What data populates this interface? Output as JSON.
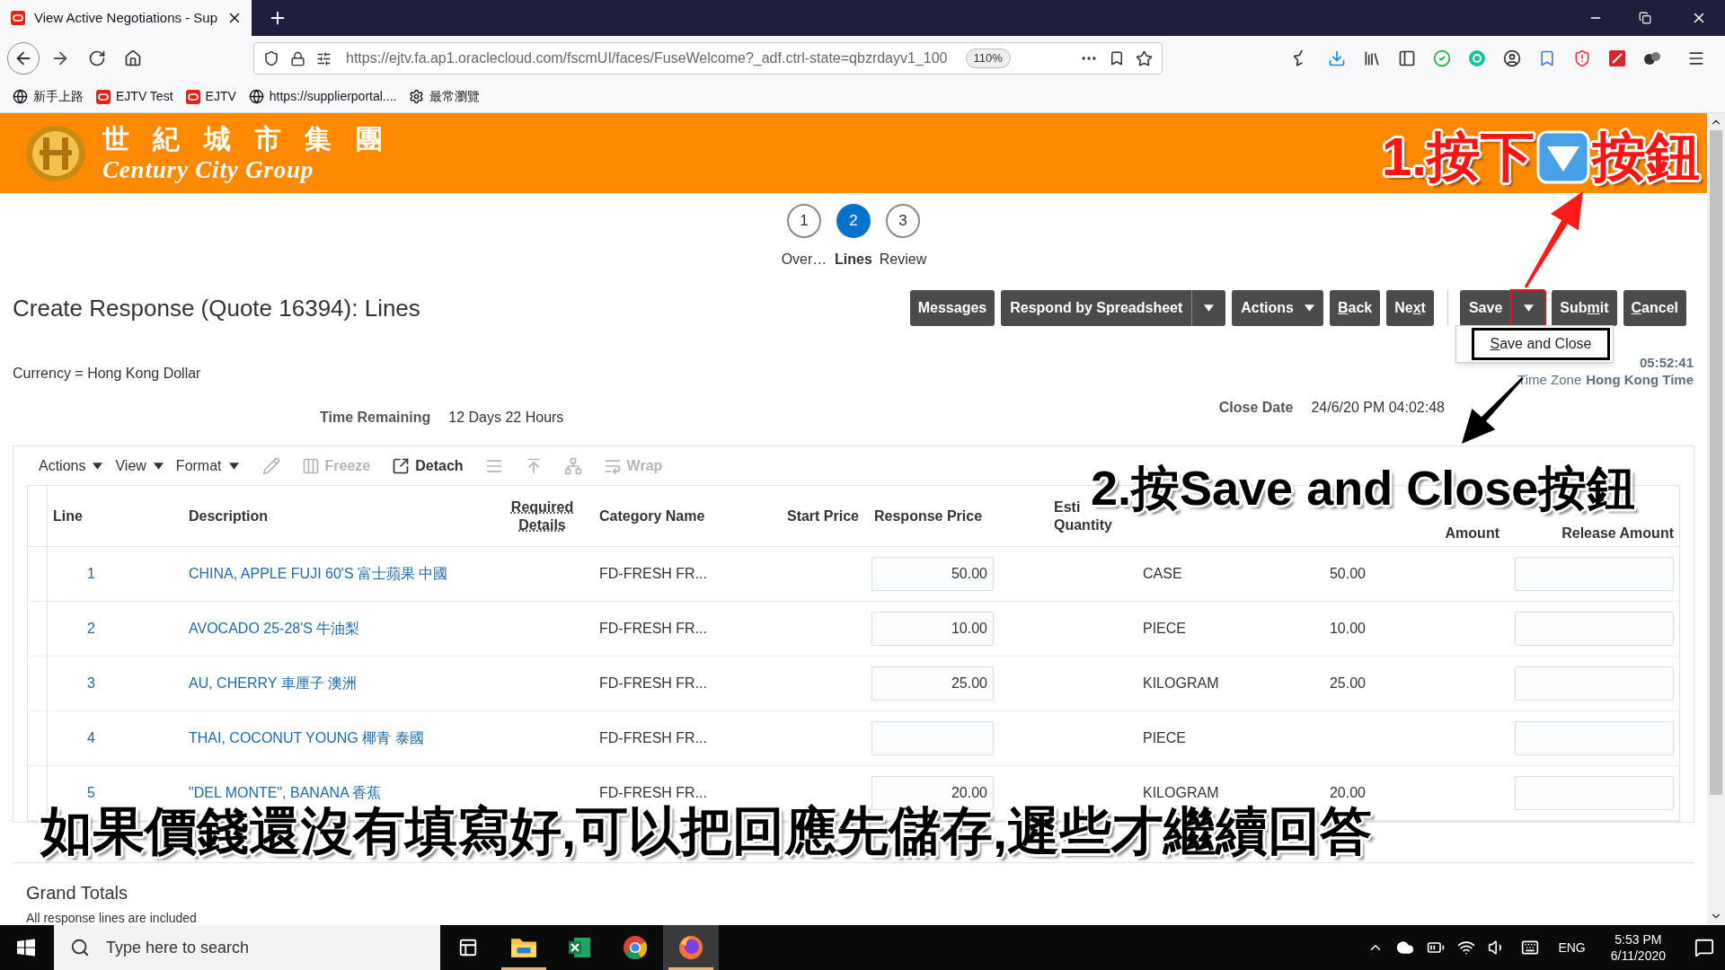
{
  "browser": {
    "tab_title": "View Active Negotiations - Sup",
    "url": "https://ejtv.fa.ap1.oraclecloud.com/fscmUI/faces/FuseWelcome?_adf.ctrl-state=qbzrdayv1_100",
    "zoom": "110%",
    "bookmarks": [
      {
        "label": "新手上路",
        "kind": "globe"
      },
      {
        "label": "EJTV Test",
        "kind": "oracle"
      },
      {
        "label": "EJTV",
        "kind": "oracle"
      },
      {
        "label": "https://supplierportal....",
        "kind": "globe"
      },
      {
        "label": "最常瀏覽",
        "kind": "gear"
      }
    ]
  },
  "header": {
    "logo_chinese": "世 紀 城 市 集 團",
    "logo_english": "Century City Group"
  },
  "train": [
    {
      "number": "1",
      "label": "Over…",
      "selected": false
    },
    {
      "number": "2",
      "label": "Lines",
      "selected": true
    },
    {
      "number": "3",
      "label": "Review",
      "selected": false
    }
  ],
  "page_title": "Create Response (Quote 16394): Lines",
  "button_groups": [
    {
      "buttons": [
        {
          "label": "Messages",
          "kind": "plain"
        },
        {
          "label": "Respond by Spreadsheet",
          "kind": "split",
          "highlighted": false
        },
        {
          "label": "Actions",
          "kind": "menu"
        },
        {
          "key": "B",
          "after": "ack",
          "kind": "plain"
        },
        {
          "before": "Ne",
          "key": "x",
          "after": "t",
          "kind": "plain"
        }
      ]
    },
    {
      "buttons": [
        {
          "label": "Save",
          "kind": "split",
          "highlighted": true
        },
        {
          "before": "Sub",
          "key": "m",
          "after": "it",
          "kind": "plain"
        },
        {
          "key": "C",
          "after": "ancel",
          "kind": "plain"
        }
      ]
    }
  ],
  "save_menu": {
    "items": [
      {
        "key": "S",
        "after": "ave and Close",
        "highlighted": true
      }
    ]
  },
  "currency": "Currency = Hong Kong Dollar",
  "last_saved": {
    "value": "05:52:41"
  },
  "time_zone": {
    "label": "Time Zone",
    "value": "Hong Kong Time"
  },
  "time_remaining": {
    "label": "Time Remaining",
    "value": "12 Days 22 Hours"
  },
  "close_date": {
    "label": "Close Date",
    "value": "24/6/20 PM 04:02:48"
  },
  "table_toolbar": [
    {
      "kind": "menu",
      "label": "Actions",
      "disabled": false
    },
    {
      "kind": "menu",
      "label": "View",
      "disabled": false
    },
    {
      "kind": "menu",
      "label": "Format",
      "disabled": false
    },
    {
      "kind": "edit",
      "disabled": true
    },
    {
      "kind": "freeze",
      "label": "Freeze",
      "disabled": true
    },
    {
      "kind": "detach",
      "label": "Detach",
      "disabled": false
    },
    {
      "kind": "lines",
      "disabled": true
    },
    {
      "kind": "top",
      "disabled": true
    },
    {
      "kind": "tree",
      "disabled": true
    },
    {
      "kind": "wrap",
      "label": "Wrap",
      "disabled": true
    }
  ],
  "table": {
    "headers": [
      {
        "lines": [
          "Line"
        ]
      },
      {
        "lines": [
          "Description"
        ]
      },
      {
        "lines": [
          "Required",
          "Details"
        ]
      },
      {
        "lines": [
          "Category Name"
        ]
      },
      {
        "lines": [
          "Start Price"
        ]
      },
      {
        "lines": [
          "Response Price"
        ]
      },
      {
        "lines": [
          "Esti",
          "Quantity"
        ]
      },
      {
        "lines": [
          "Amount"
        ]
      },
      {
        "lines": [
          "Release Amount"
        ]
      }
    ],
    "rows": [
      {
        "line": "1",
        "description": "CHINA, APPLE FUJI 60'S 富士蘋果 中國",
        "category": "FD-FRESH FR...",
        "response_price": "50.00",
        "uom": "CASE",
        "line_amount": "50.00"
      },
      {
        "line": "2",
        "description": "AVOCADO 25-28'S 牛油梨",
        "category": "FD-FRESH FR...",
        "response_price": "10.00",
        "uom": "PIECE",
        "line_amount": "10.00"
      },
      {
        "line": "3",
        "description": "AU, CHERRY 車厘子 澳洲",
        "category": "FD-FRESH FR...",
        "response_price": "25.00",
        "uom": "KILOGRAM",
        "line_amount": "25.00"
      },
      {
        "line": "4",
        "description": "THAI, COCONUT YOUNG 椰青 泰國",
        "category": "FD-FRESH FR...",
        "uom": "PIECE"
      },
      {
        "line": "5",
        "description": "\"DEL MONTE\", BANANA 香蕉",
        "category": "FD-FRESH FR...",
        "response_price": "20.00",
        "uom": "KILOGRAM",
        "line_amount": "20.00"
      }
    ]
  },
  "grand_totals": {
    "title": "Grand Totals",
    "note": "All response lines are included"
  },
  "annotations": {
    "step1": {
      "before": "1.按下",
      "after": "按鈕"
    },
    "step2": "2.按Save and Close按鈕",
    "caption": "如果價錢還沒有填寫好,可以把回應先儲存,遲些才繼續回答"
  },
  "taskbar": {
    "search_placeholder": "Type here to search",
    "apps": [
      {
        "kind": "taskview",
        "selected": false,
        "running": false
      },
      {
        "kind": "explorer",
        "selected": false,
        "running": true
      },
      {
        "kind": "excel",
        "selected": false,
        "running": false
      },
      {
        "kind": "chrome",
        "selected": false,
        "running": false
      },
      {
        "kind": "firefox",
        "selected": true,
        "running": true
      }
    ],
    "language": "ENG",
    "time": "5:53 PM",
    "date": "6/11/2020"
  }
}
